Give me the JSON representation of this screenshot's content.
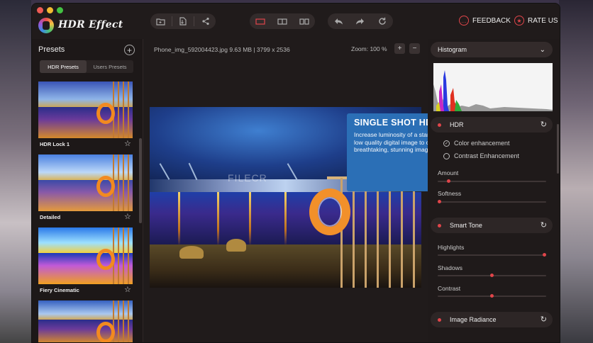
{
  "app": {
    "title": "HDR Effect"
  },
  "toolbar": {
    "feedback_label": "FEEDBACK",
    "rate_label": "RATE US"
  },
  "sidebar": {
    "title": "Presets",
    "tabs": [
      {
        "label": "HDR Presets",
        "active": true
      },
      {
        "label": "Users Presets",
        "active": false
      }
    ],
    "presets": [
      {
        "label": "HDR Lock 1"
      },
      {
        "label": "Detailed"
      },
      {
        "label": "Fiery Cinematic"
      },
      {
        "label": ""
      }
    ]
  },
  "main": {
    "file_info": "Phone_img_592004423.jpg  9.63 MB  |  3799 x 2536",
    "zoom": "Zoom: 100 %",
    "zoom_in": "+",
    "zoom_out": "−",
    "watermark": "FILECR"
  },
  "tooltip": {
    "title": "SINGLE SHOT HDR",
    "body": "Increase luminosity of a standard low quality digital image to create breathtaking, stunning images."
  },
  "panel": {
    "histogram_label": "Histogram",
    "hdr": {
      "title": "HDR",
      "options": [
        {
          "label": "Color enhancement",
          "checked": true
        },
        {
          "label": "Contrast Enhancement",
          "checked": false
        }
      ],
      "sliders": [
        {
          "label": "Amount",
          "value": "15",
          "fraction": 0.09
        },
        {
          "label": "Softness",
          "value": "0",
          "fraction": 0.0
        }
      ]
    },
    "smart_tone": {
      "title": "Smart Tone",
      "sliders": [
        {
          "label": "Highlights",
          "value": "100",
          "fraction": 1.0
        },
        {
          "label": "Shadows",
          "value": "0",
          "fraction": 0.5
        },
        {
          "label": "Contrast",
          "value": "0",
          "fraction": 0.5
        }
      ]
    },
    "image_radiance": {
      "title": "Image Radiance"
    }
  },
  "colors": {
    "accent_red": "#e0454a",
    "tooltip_blue": "#2b6fb6",
    "window_bg": "#211c1c"
  }
}
